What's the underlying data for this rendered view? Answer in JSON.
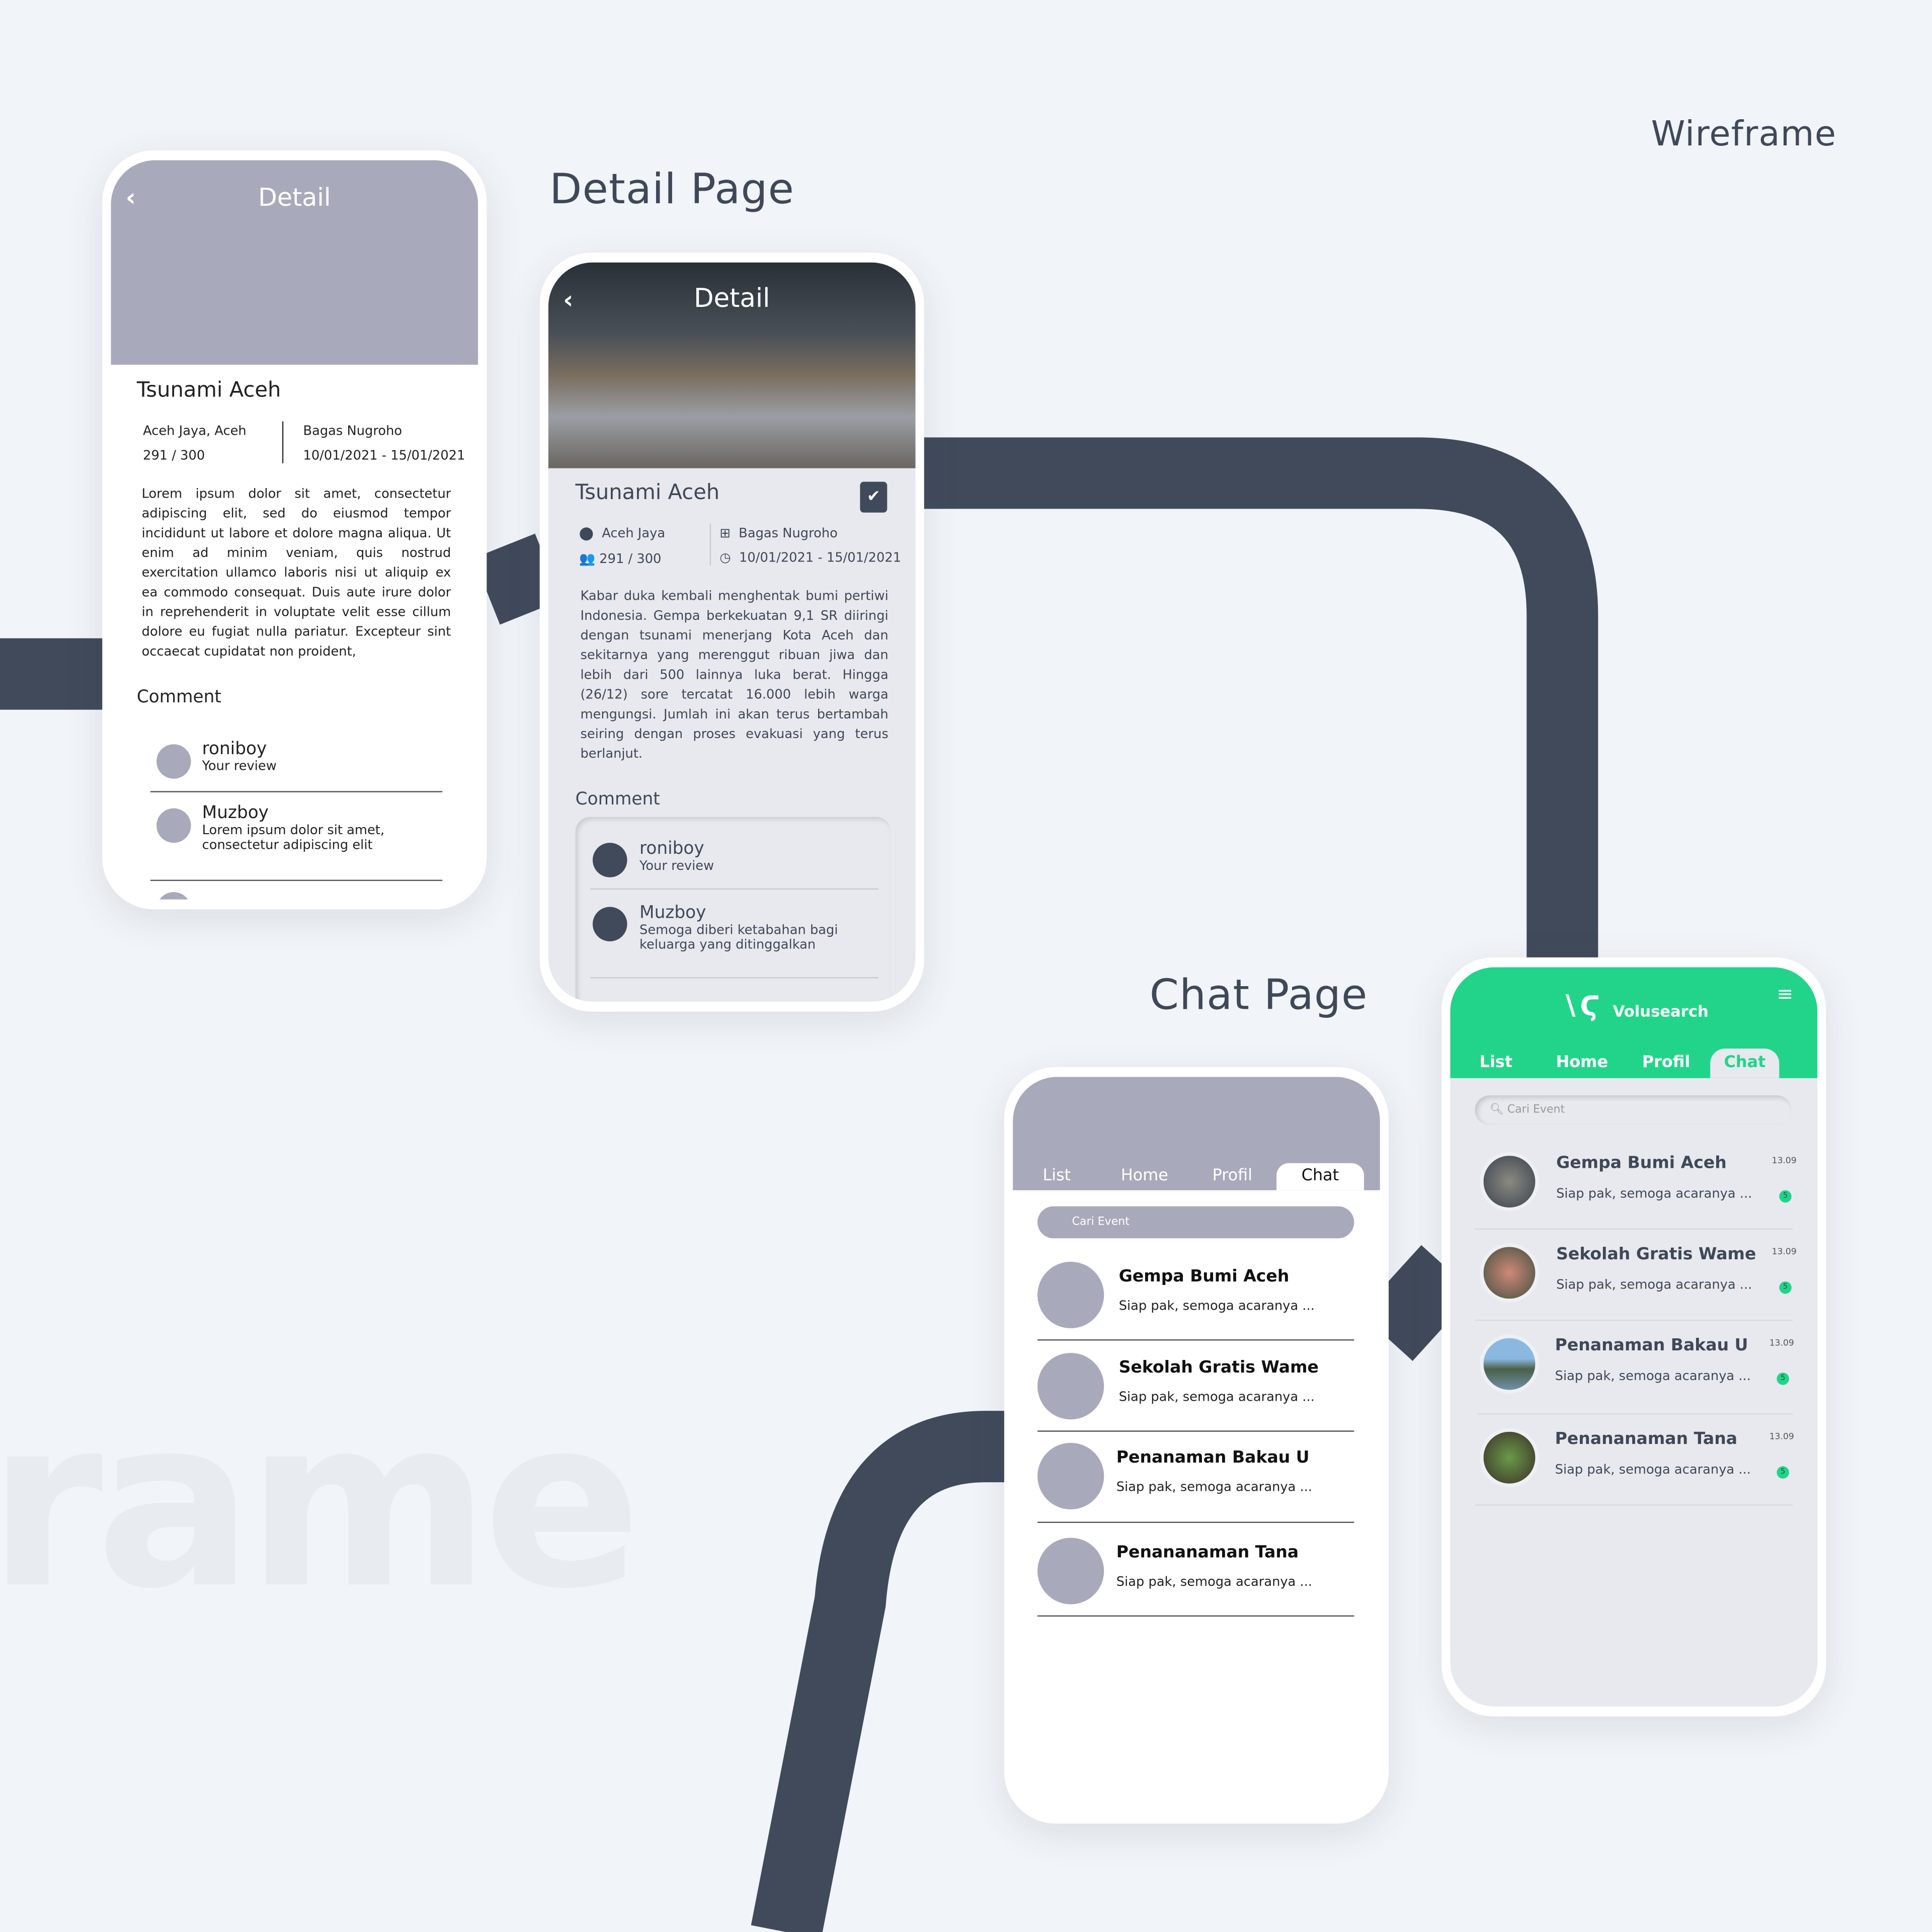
{
  "labels": {
    "wireframe": "Wireframe",
    "detail_page": "Detail Page",
    "chat_page": "Chat Page",
    "ghost_text": "rame"
  },
  "colors": {
    "background": "#f1f4f8",
    "road": "#404a5b",
    "wire_gray": "#a8aabb",
    "brand_green": "#22d48a",
    "text_dark": "#3f4858"
  },
  "wire_detail": {
    "header_title": "Detail",
    "back_icon": "chevron-left",
    "title": "Tsunami Aceh",
    "location": "Aceh Jaya, Aceh",
    "participants": "291 / 300",
    "organizer": "Bagas Nugroho",
    "dates": "10/01/2021 - 15/01/2021",
    "description": "Lorem ipsum dolor sit amet, consectetur adipiscing elit, sed do eiusmod tempor incididunt ut labore et dolore magna aliqua. Ut enim ad minim veniam, quis nostrud exercitation ullamco laboris nisi ut aliquip ex ea commodo consequat. Duis aute irure dolor in reprehenderit in voluptate velit esse cillum dolore eu fugiat nulla pariatur. Excepteur sint occaecat cupidatat non proident,",
    "comment_heading": "Comment",
    "comments": [
      {
        "name": "roniboy",
        "text": "Your review"
      },
      {
        "name": "Muzboy",
        "text": "Lorem ipsum dolor sit amet, consectetur adipiscing elit"
      }
    ]
  },
  "detail": {
    "header_title": "Detail",
    "title": "Tsunami Aceh",
    "location": "Aceh Jaya",
    "participants": "291 / 300",
    "organizer": "Bagas Nugroho",
    "dates": "10/01/2021 - 15/01/2021",
    "description": "Kabar duka kembali menghentak bumi pertiwi Indonesia. Gempa berkekuatan 9,1 SR diiringi dengan tsunami menerjang Kota Aceh dan sekitarnya yang merenggut ribuan jiwa dan lebih dari 500 lainnya luka berat. Hingga (26/12) sore tercatat 16.000 lebih warga mengungsi. Jumlah ini akan terus bertambah seiring dengan proses evakuasi yang terus berlanjut.",
    "comment_heading": "Comment",
    "comments": [
      {
        "name": "roniboy",
        "text": "Your review"
      },
      {
        "name": "Muzboy",
        "text": "Semoga diberi ketabahan bagi keluarga yang ditinggalkan"
      }
    ]
  },
  "wire_chat": {
    "tabs": [
      "List",
      "Home",
      "Profil",
      "Chat"
    ],
    "active_tab": "Chat",
    "search_placeholder": "Cari Event",
    "rows": [
      {
        "title": "Gempa Bumi Aceh",
        "preview": "Siap pak, semoga acaranya ..."
      },
      {
        "title": "Sekolah Gratis Wame",
        "preview": "Siap pak, semoga acaranya ..."
      },
      {
        "title": "Penanaman Bakau U",
        "preview": "Siap pak, semoga acaranya ..."
      },
      {
        "title": "Penananaman Tana",
        "preview": "Siap pak, semoga acaranya ..."
      }
    ]
  },
  "chat": {
    "brand": "Volusearch",
    "tabs": [
      "List",
      "Home",
      "Profil",
      "Chat"
    ],
    "active_tab": "Chat",
    "search_placeholder": "Cari Event",
    "rows": [
      {
        "title": "Gempa Bumi Aceh",
        "preview": "Siap pak, semoga acaranya ...",
        "time": "13.09",
        "unread": "5"
      },
      {
        "title": "Sekolah Gratis Wame",
        "preview": "Siap pak, semoga acaranya ...",
        "time": "13.09",
        "unread": "5"
      },
      {
        "title": "Penanaman Bakau U",
        "preview": "Siap pak, semoga acaranya ...",
        "time": "13.09",
        "unread": "5"
      },
      {
        "title": "Penananaman Tana",
        "preview": "Siap pak, semoga acaranya ...",
        "time": "13.09",
        "unread": "5"
      }
    ]
  }
}
